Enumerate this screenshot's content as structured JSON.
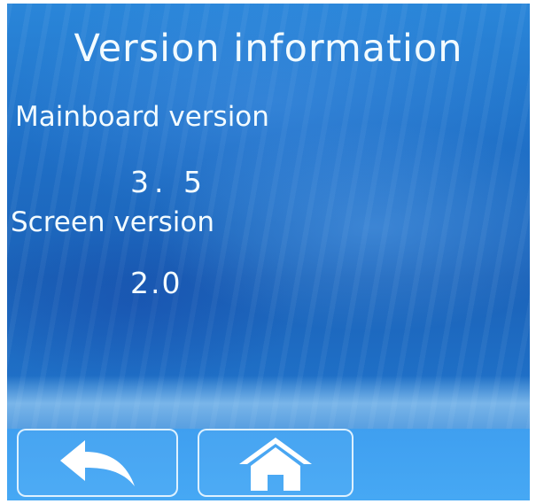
{
  "title": "Version information",
  "mainboard": {
    "label": "Mainboard version",
    "value": "3. 5"
  },
  "screen": {
    "label": "Screen version",
    "value": "2.0"
  },
  "nav": {
    "back_icon": "back-arrow-icon",
    "home_icon": "home-icon"
  },
  "colors": {
    "text": "#f2fbff",
    "background": "#1f6fc6",
    "button_border": "#e6f6ff"
  }
}
